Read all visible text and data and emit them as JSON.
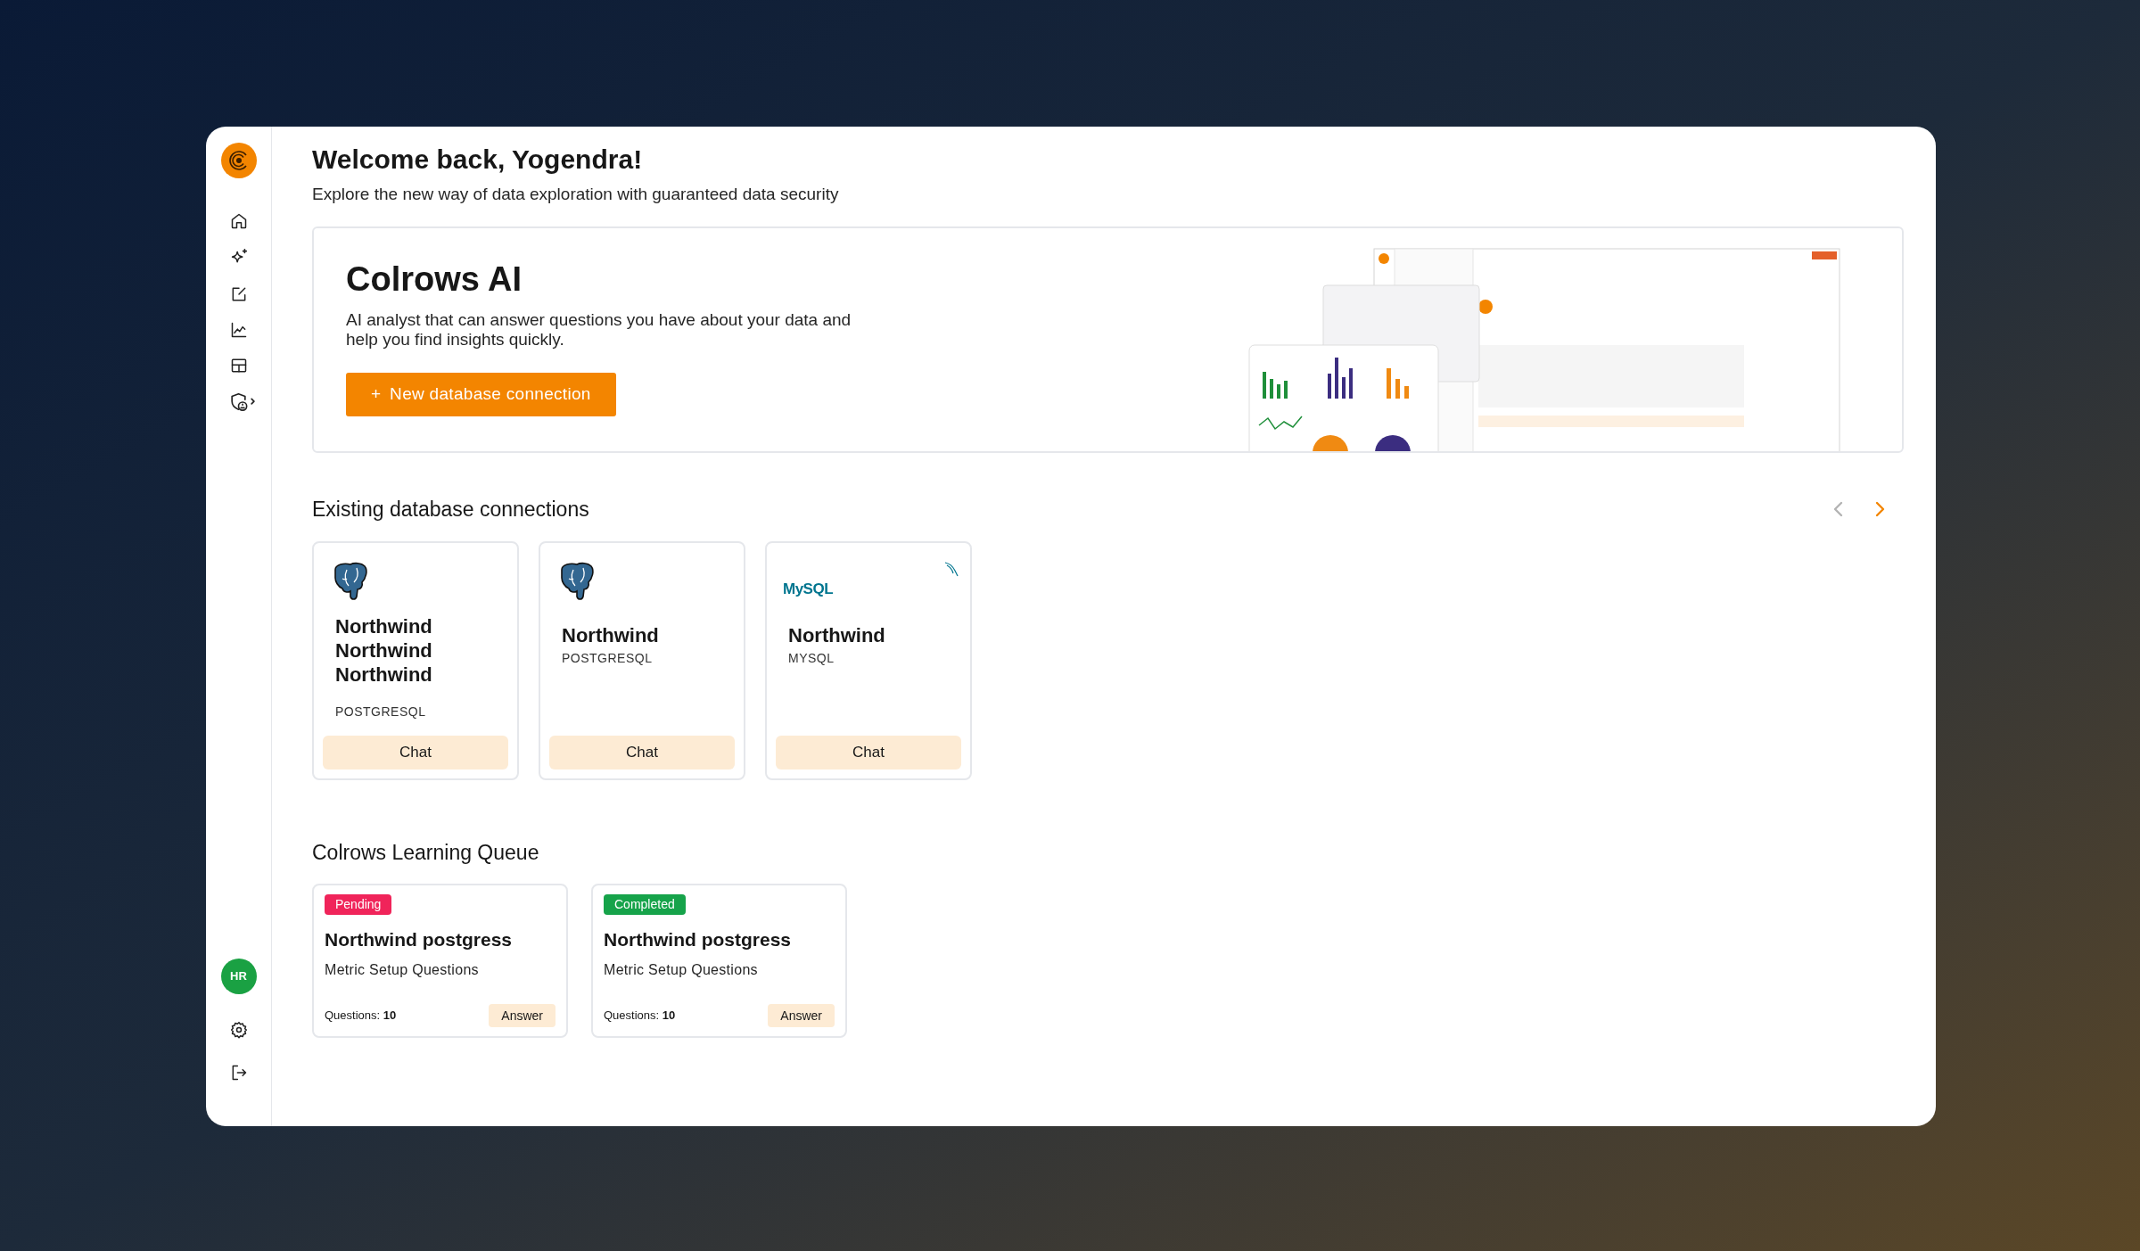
{
  "sidebar": {
    "nav": [
      {
        "kind": "home"
      },
      {
        "kind": "sparkle"
      },
      {
        "kind": "edit"
      },
      {
        "kind": "chart"
      },
      {
        "kind": "layout"
      },
      {
        "kind": "shield"
      }
    ],
    "avatar": "HR",
    "bottom": [
      {
        "kind": "settings"
      },
      {
        "kind": "logout"
      }
    ]
  },
  "header": {
    "title": "Welcome back, Yogendra!",
    "subtitle": "Explore the new way of data exploration with guaranteed data security"
  },
  "hero": {
    "title": "Colrows AI",
    "description": "AI analyst that can answer questions you have about your data and help you find insights quickly.",
    "button": {
      "icon": "+",
      "label": "New database connection"
    }
  },
  "connections": {
    "title": "Existing database connections",
    "prev_disabled": true,
    "next_disabled": false,
    "cards": [
      {
        "kind": "postgresql",
        "name": "Northwind Northwind Northwind",
        "type": "POSTGRESQL",
        "action": "Chat"
      },
      {
        "kind": "postgresql",
        "name": "Northwind",
        "type": "POSTGRESQL",
        "action": "Chat"
      },
      {
        "kind": "mysql",
        "logo_text": "MySQL",
        "name": "Northwind",
        "type": "MYSQL",
        "action": "Chat"
      }
    ]
  },
  "queue": {
    "title": "Colrows Learning Queue",
    "items": [
      {
        "status": "Pending",
        "color": "#f0245a",
        "name": "Northwind postgress",
        "subtitle": "Metric Setup Questions",
        "questions": "Questions: **10**",
        "action": "Answer"
      },
      {
        "status": "Completed",
        "color": "#16a34a",
        "name": "Northwind postgress",
        "subtitle": "Metric Setup Questions",
        "questions": "Questions: **10**",
        "action": "Answer"
      }
    ]
  }
}
